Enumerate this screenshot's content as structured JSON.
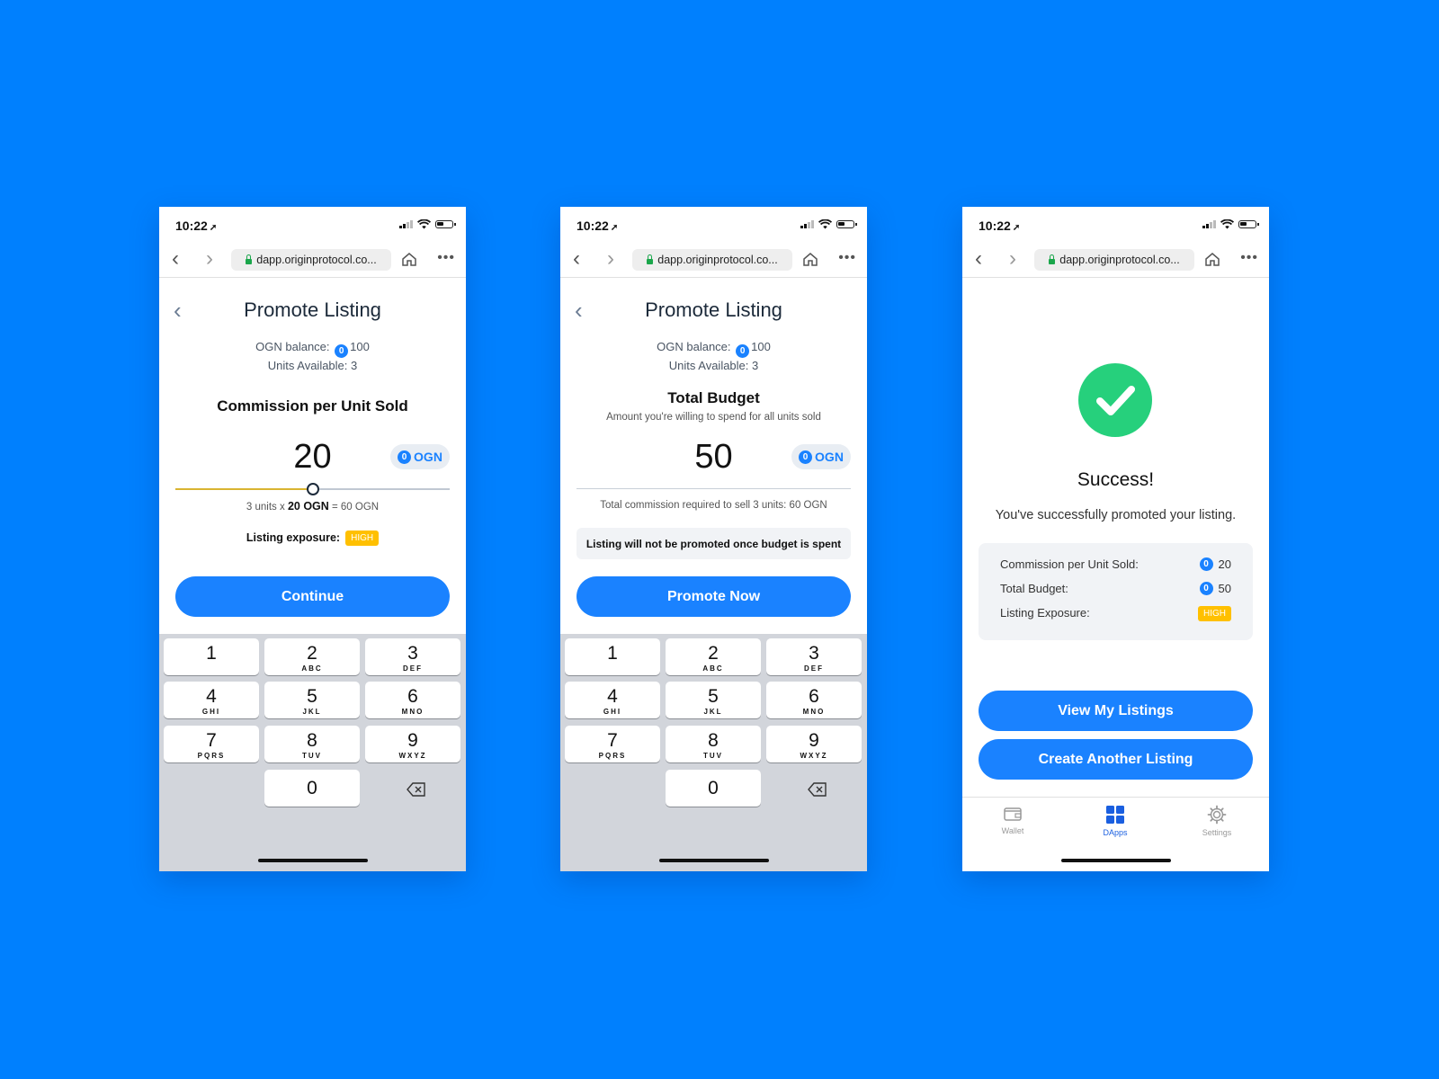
{
  "status": {
    "time": "10:22",
    "location_icon": "location-arrow-icon"
  },
  "browser": {
    "url": "dapp.originprotocol.co..."
  },
  "screen1": {
    "title": "Promote Listing",
    "balance_label": "OGN balance:",
    "balance_value": "100",
    "units_available": "Units Available: 3",
    "section_title": "Commission per Unit Sold",
    "value": "20",
    "token": "OGN",
    "slider_fraction": 0.5,
    "calc_prefix": "3 units x",
    "calc_bold": "20 OGN",
    "calc_suffix": "= 60 OGN",
    "exposure_label": "Listing exposure:",
    "exposure_badge": "HIGH",
    "button": "Continue"
  },
  "screen2": {
    "title": "Promote Listing",
    "balance_label": "OGN balance:",
    "balance_value": "100",
    "units_available": "Units Available: 3",
    "section_title": "Total Budget",
    "subtitle": "Amount you're willing to spend for all units sold",
    "value": "50",
    "token": "OGN",
    "commission_note": "Total commission required to sell 3 units: 60 OGN",
    "warning": "Listing will not be promoted once budget is spent",
    "button": "Promote Now"
  },
  "keypad": [
    {
      "digit": "1",
      "letters": ""
    },
    {
      "digit": "2",
      "letters": "ABC"
    },
    {
      "digit": "3",
      "letters": "DEF"
    },
    {
      "digit": "4",
      "letters": "GHI"
    },
    {
      "digit": "5",
      "letters": "JKL"
    },
    {
      "digit": "6",
      "letters": "MNO"
    },
    {
      "digit": "7",
      "letters": "PQRS"
    },
    {
      "digit": "8",
      "letters": "TUV"
    },
    {
      "digit": "9",
      "letters": "WXYZ"
    },
    {
      "digit": "0",
      "letters": ""
    }
  ],
  "screen3": {
    "success_title": "Success!",
    "success_message": "You've successfully promoted your listing.",
    "summary": {
      "commission_label": "Commission per Unit Sold:",
      "commission_value": "20",
      "budget_label": "Total Budget:",
      "budget_value": "50",
      "exposure_label": "Listing Exposure:",
      "exposure_badge": "HIGH"
    },
    "button_primary": "View My Listings",
    "button_secondary": "Create Another Listing",
    "tabs": [
      {
        "label": "Wallet",
        "icon": "wallet-icon",
        "active": false
      },
      {
        "label": "DApps",
        "icon": "grid-icon",
        "active": true
      },
      {
        "label": "Settings",
        "icon": "gear-icon",
        "active": false
      }
    ]
  },
  "colors": {
    "background": "#0080fe",
    "primary": "#1a82ff",
    "success": "#26d07c",
    "badge": "#ffc000",
    "slider_fill": "#d9b431"
  }
}
